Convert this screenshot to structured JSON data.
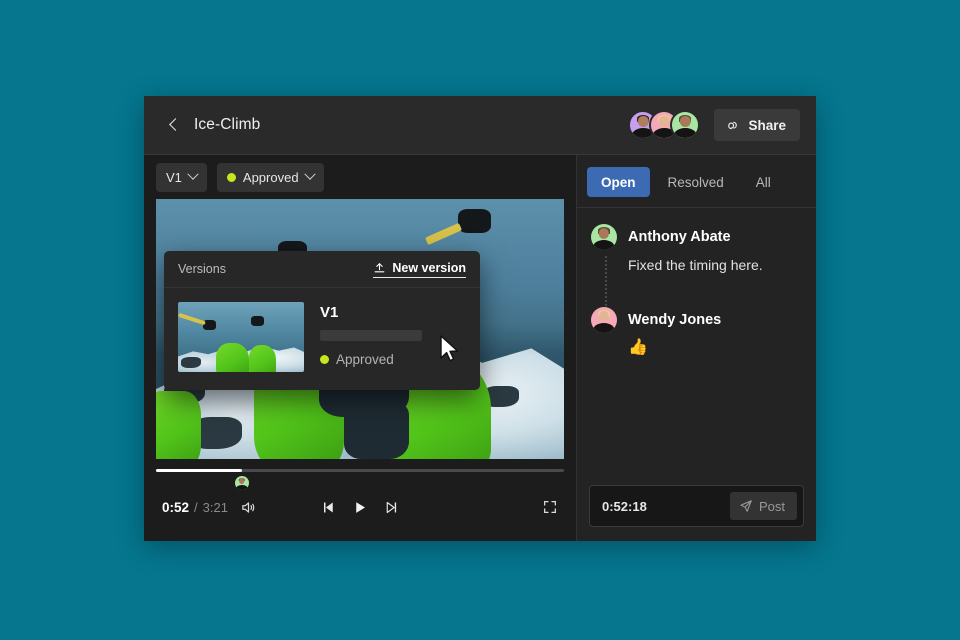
{
  "desktop": {
    "background_color": "#05768e"
  },
  "window": {
    "header": {
      "back_icon": "chevron-left-icon",
      "title": "Ice-Climb",
      "collaborators": [
        {
          "name": "Collaborator 1",
          "bg_color": "#c49ef0"
        },
        {
          "name": "Collaborator 2",
          "bg_color": "#f5a9b8"
        },
        {
          "name": "Collaborator 3",
          "bg_color": "#a8e6a3"
        }
      ],
      "share": {
        "icon": "link-icon",
        "label": "Share"
      }
    },
    "toolbar": {
      "version_chip": {
        "label": "V1",
        "caret_icon": "chevron-down-icon"
      },
      "status_chip": {
        "label": "Approved",
        "dot_icon": "status-dot-icon",
        "dot_color": "#c8e61e",
        "caret_icon": "chevron-down-icon"
      }
    },
    "versions_popover": {
      "title": "Versions",
      "new_version": {
        "icon": "upload-icon",
        "label": "New version"
      },
      "items": [
        {
          "name": "V1",
          "status_label": "Approved",
          "status_color": "#c8e61e",
          "thumbnail": "video-thumbnail"
        }
      ]
    },
    "player": {
      "progress_percent": 26,
      "marker_percent": 21,
      "current_time": "0:52",
      "separator": "/",
      "duration": "3:21",
      "volume_icon": "volume-icon",
      "prev_frame_icon": "previous-frame-icon",
      "play_icon": "play-icon",
      "next_frame_icon": "next-frame-icon",
      "fullscreen_icon": "fullscreen-icon",
      "marker_avatar_color": "#a8e6a3"
    },
    "comments": {
      "tabs": [
        {
          "label": "Open",
          "active": true
        },
        {
          "label": "Resolved",
          "active": false
        },
        {
          "label": "All",
          "active": false
        }
      ],
      "items": [
        {
          "author": "Anthony Abate",
          "avatar_color": "#a8e6a3",
          "text": "Fixed the timing here.",
          "emoji": ""
        },
        {
          "author": "Wendy Jones",
          "avatar_color": "#f5a9b8",
          "text": "",
          "emoji": "👍"
        }
      ],
      "composer": {
        "timecode": "0:52:18",
        "post_icon": "send-icon",
        "post_label": "Post"
      }
    },
    "accent_colors": {
      "tab_active": "#3d6bb3",
      "approved": "#c8e61e"
    }
  }
}
